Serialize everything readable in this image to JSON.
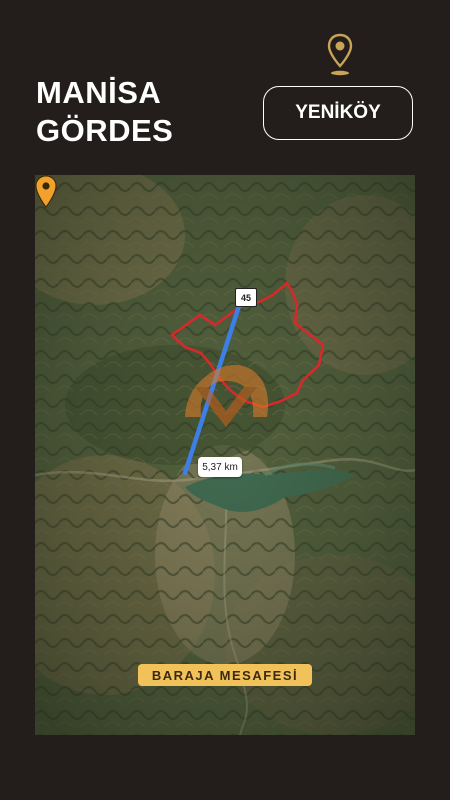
{
  "header": {
    "city": "MANİSA",
    "district": "GÖRDES",
    "neighborhood": "YENİKÖY"
  },
  "map": {
    "road_number": "45",
    "distance": "5,37 km",
    "caption": "BARAJA MESAFESİ",
    "colors": {
      "pin": "#f0a22c",
      "boundary": "#d42a2a",
      "route": "#3d7fe6",
      "caption_bg": "#f2c25a",
      "reservoir": "#3f6b52"
    }
  }
}
